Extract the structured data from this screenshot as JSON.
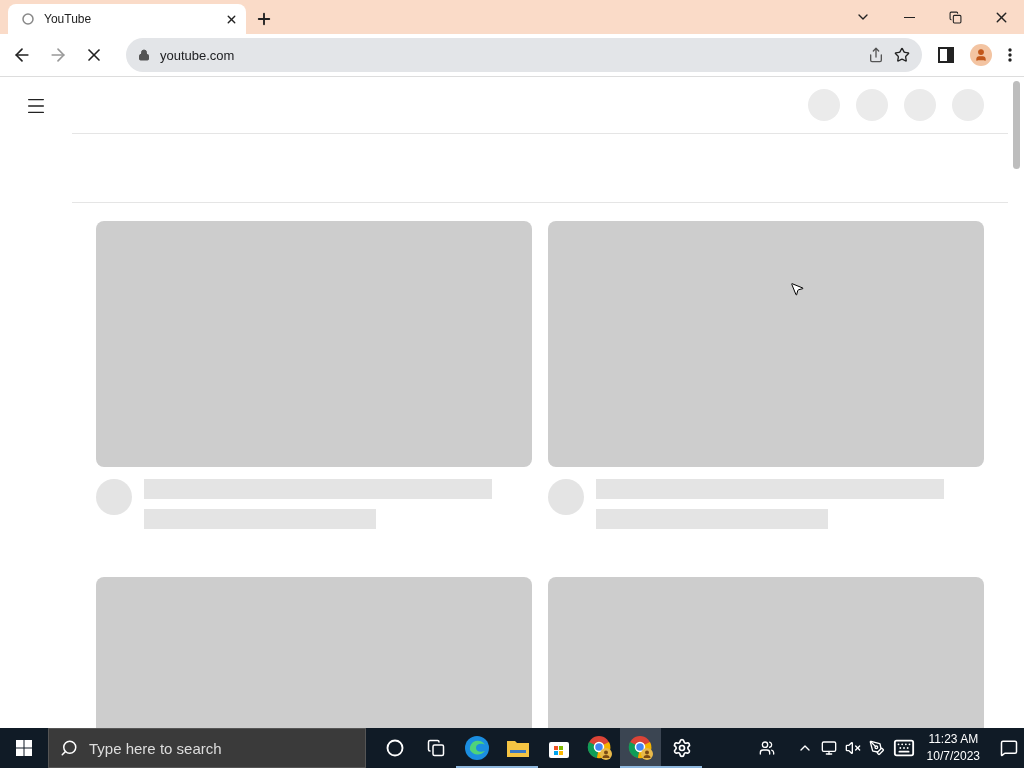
{
  "browser": {
    "tabs": [
      {
        "title": "YouTube",
        "selected": true
      }
    ],
    "loading": true,
    "url": "youtube.com"
  },
  "page": {
    "header_placeholders": [
      {
        "kind": "circle"
      },
      {
        "kind": "circle"
      },
      {
        "kind": "circle"
      },
      {
        "kind": "circle"
      }
    ],
    "feed": [
      {
        "kind": "skeleton"
      },
      {
        "kind": "skeleton"
      },
      {
        "kind": "thumbnail"
      },
      {
        "kind": "thumbnail"
      }
    ]
  },
  "taskbar": {
    "search": {
      "placeholder": "Type here to search"
    },
    "apps": [
      {
        "kind": "cortana",
        "running": false,
        "selected": false
      },
      {
        "kind": "taskview",
        "running": false,
        "selected": false
      },
      {
        "kind": "edge",
        "running": true,
        "selected": false
      },
      {
        "kind": "explorer",
        "running": true,
        "selected": false
      },
      {
        "kind": "store",
        "running": false,
        "selected": false
      },
      {
        "kind": "chrome",
        "running": false,
        "selected": false
      },
      {
        "kind": "chrome",
        "running": true,
        "selected": true
      },
      {
        "kind": "settings",
        "running": true,
        "selected": false
      }
    ],
    "time": "11:23 AM",
    "date": "10/7/2023"
  }
}
